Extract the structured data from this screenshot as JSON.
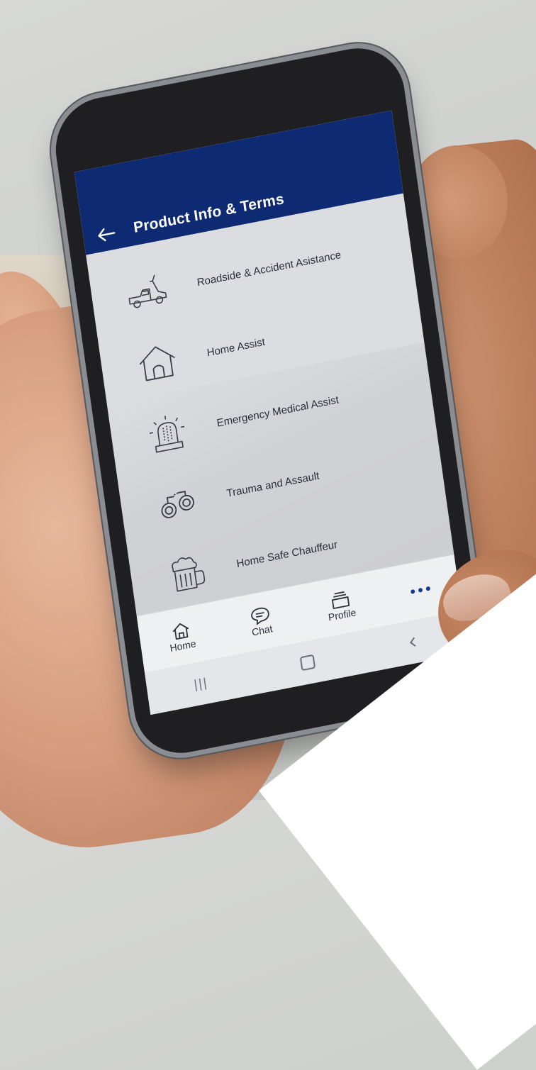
{
  "app": {
    "title": "Product Info & Terms"
  },
  "menu": {
    "items": [
      {
        "label": "Roadside & Accident Asistance",
        "icon": "tow-truck-icon"
      },
      {
        "label": "Home Assist",
        "icon": "house-icon"
      },
      {
        "label": "Emergency Medical Assist",
        "icon": "siren-icon"
      },
      {
        "label": "Trauma and Assault",
        "icon": "handcuffs-icon"
      },
      {
        "label": "Home Safe Chauffeur",
        "icon": "beer-mug-icon"
      }
    ]
  },
  "tabs": {
    "home": "Home",
    "chat": "Chat",
    "profile": "Profile"
  },
  "colors": {
    "header": "#0d2a73",
    "screen_bg": "#dcdde1",
    "accent": "#163b8f"
  }
}
